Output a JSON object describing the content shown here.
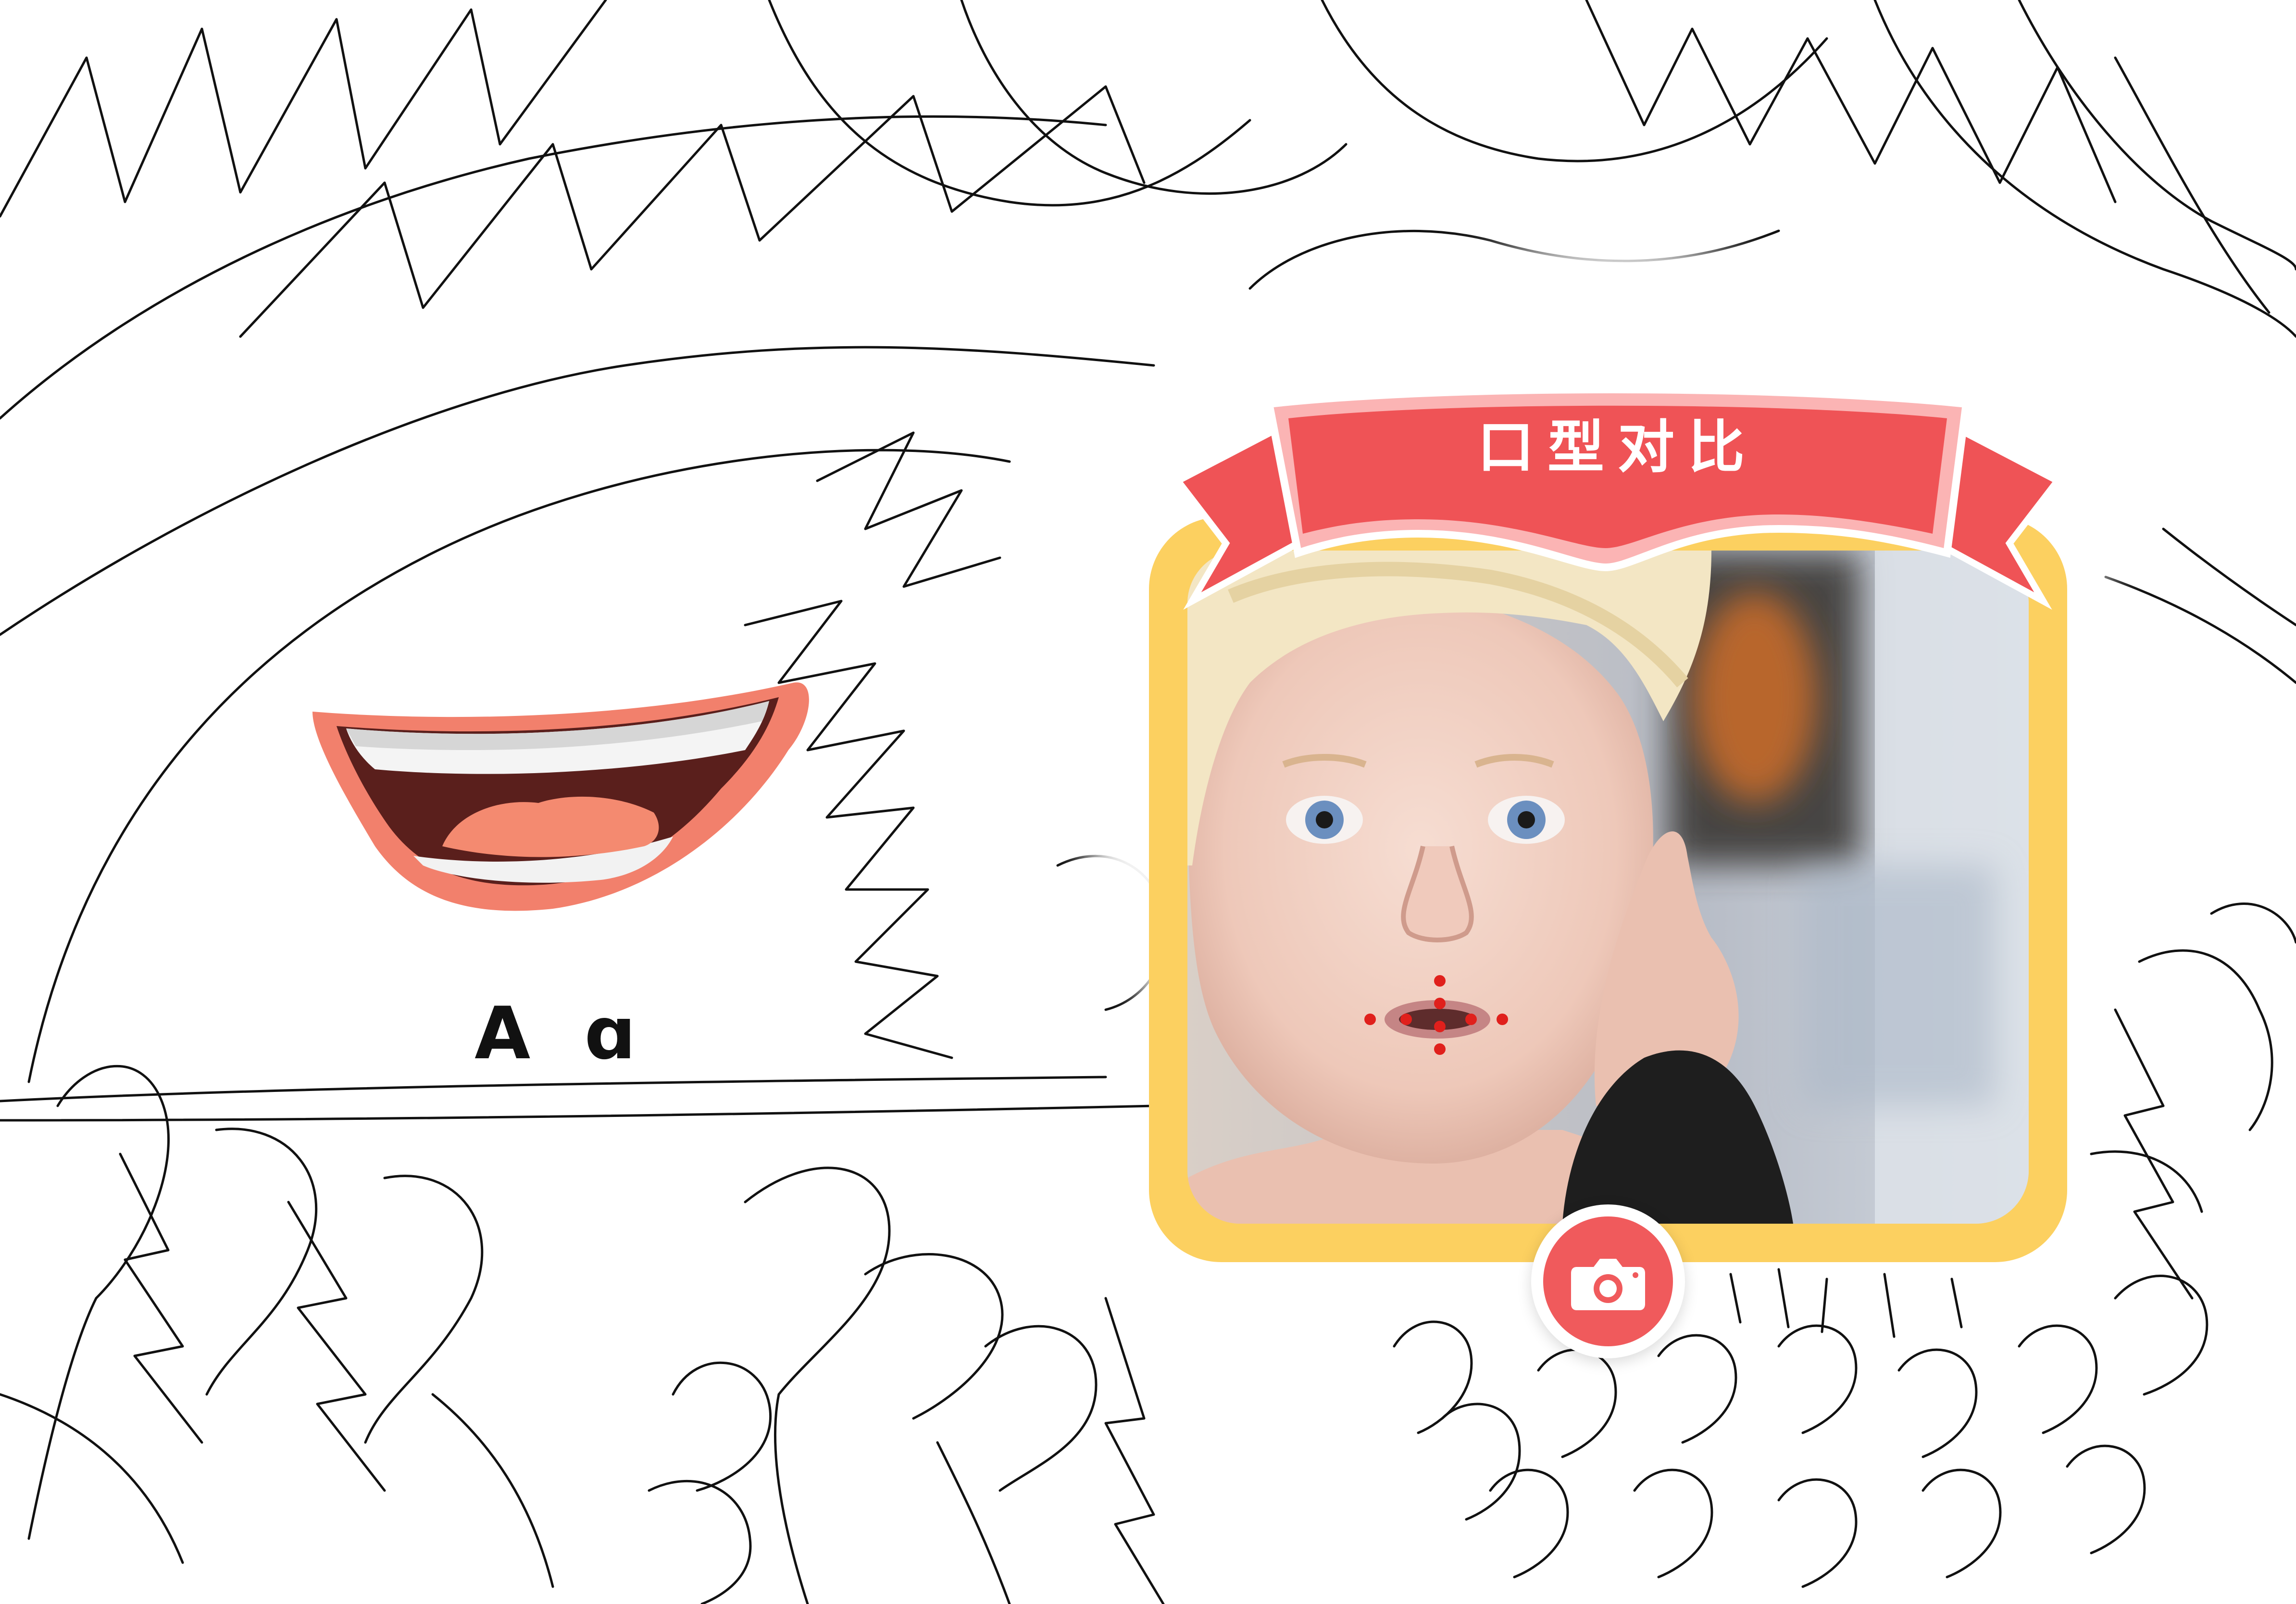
{
  "lesson": {
    "letter_label": "A ɑ",
    "panel_title": "口型对比"
  },
  "icons": {
    "mouth_illustration": "open-mouth-icon",
    "camera": "camera-icon"
  },
  "colors": {
    "ribbon": "#ef5356",
    "ribbon_light": "#fbb4b4",
    "frame": "#fcd060",
    "lips": "#f2806c",
    "mouth_inside": "#5a1f1c",
    "tongue": "#f48a70",
    "camera_button": "#f05a5c"
  }
}
